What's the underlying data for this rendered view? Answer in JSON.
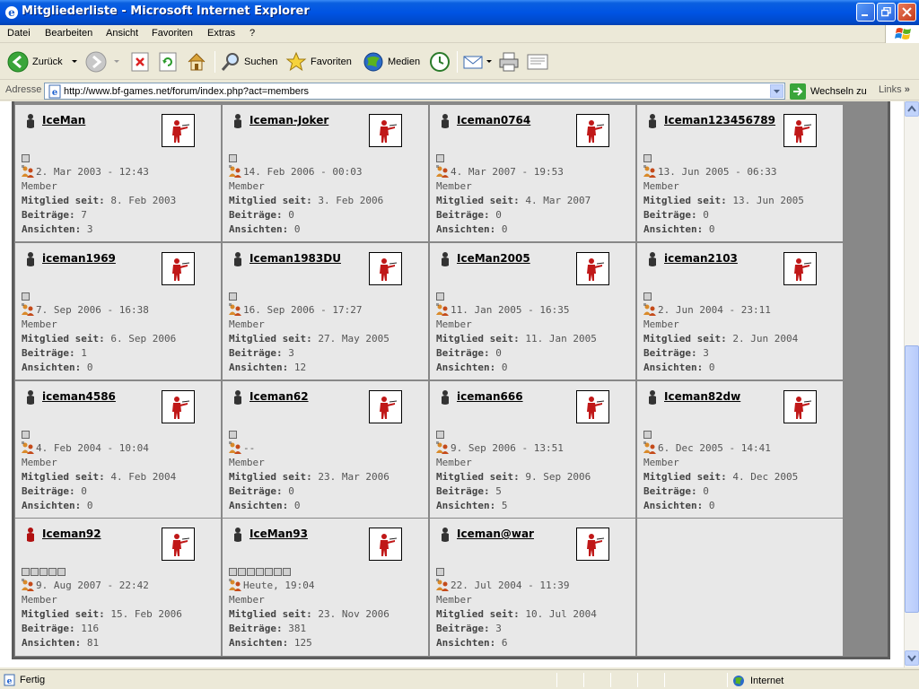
{
  "window": {
    "title": "Mitgliederliste - Microsoft Internet Explorer"
  },
  "menu": [
    "Datei",
    "Bearbeiten",
    "Ansicht",
    "Favoriten",
    "Extras",
    "?"
  ],
  "toolbar": {
    "back": "Zurück",
    "search": "Suchen",
    "favorites": "Favoriten",
    "media": "Medien"
  },
  "address": {
    "label": "Adresse",
    "url": "http://www.bf-games.net/forum/index.php?act=members",
    "go": "Wechseln zu",
    "links": "Links"
  },
  "status": {
    "text": "Fertig",
    "zone": "Internet"
  },
  "members": [
    {
      "name": "IceMan",
      "pips": 1,
      "last": "2. Mar 2003 - 12:43",
      "rank": "Member",
      "since_label": "Mitglied seit:",
      "since": "8. Feb 2003",
      "posts_label": "Beiträge:",
      "posts": "7",
      "views_label": "Ansichten:",
      "views": "3",
      "icon_color": "#333"
    },
    {
      "name": "Iceman-Joker",
      "pips": 1,
      "last": "14. Feb 2006 - 00:03",
      "rank": "Member",
      "since_label": "Mitglied seit:",
      "since": "3. Feb 2006",
      "posts_label": "Beiträge:",
      "posts": "0",
      "views_label": "Ansichten:",
      "views": "0",
      "icon_color": "#333"
    },
    {
      "name": "Iceman0764",
      "pips": 1,
      "last": "4. Mar 2007 - 19:53",
      "rank": "Member",
      "since_label": "Mitglied seit:",
      "since": "4. Mar 2007",
      "posts_label": "Beiträge:",
      "posts": "0",
      "views_label": "Ansichten:",
      "views": "0",
      "icon_color": "#333"
    },
    {
      "name": "Iceman123456789",
      "pips": 1,
      "last": "13. Jun 2005 - 06:33",
      "rank": "Member",
      "since_label": "Mitglied seit:",
      "since": "13. Jun 2005",
      "posts_label": "Beiträge:",
      "posts": "0",
      "views_label": "Ansichten:",
      "views": "0",
      "icon_color": "#333"
    },
    {
      "name": "iceman1969",
      "pips": 1,
      "last": "7. Sep 2006 - 16:38",
      "rank": "Member",
      "since_label": "Mitglied seit:",
      "since": "6. Sep 2006",
      "posts_label": "Beiträge:",
      "posts": "1",
      "views_label": "Ansichten:",
      "views": "0",
      "icon_color": "#333"
    },
    {
      "name": "Iceman1983DU",
      "pips": 1,
      "last": "16. Sep 2006 - 17:27",
      "rank": "Member",
      "since_label": "Mitglied seit:",
      "since": "27. May 2005",
      "posts_label": "Beiträge:",
      "posts": "3",
      "views_label": "Ansichten:",
      "views": "12",
      "icon_color": "#333"
    },
    {
      "name": "IceMan2005",
      "pips": 1,
      "last": "11. Jan 2005 - 16:35",
      "rank": "Member",
      "since_label": "Mitglied seit:",
      "since": "11. Jan 2005",
      "posts_label": "Beiträge:",
      "posts": "0",
      "views_label": "Ansichten:",
      "views": "0",
      "icon_color": "#333"
    },
    {
      "name": "iceman2103",
      "pips": 1,
      "last": "2. Jun 2004 - 23:11",
      "rank": "Member",
      "since_label": "Mitglied seit:",
      "since": "2. Jun 2004",
      "posts_label": "Beiträge:",
      "posts": "3",
      "views_label": "Ansichten:",
      "views": "0",
      "icon_color": "#333"
    },
    {
      "name": "iceman4586",
      "pips": 1,
      "last": "4. Feb 2004 - 10:04",
      "rank": "Member",
      "since_label": "Mitglied seit:",
      "since": "4. Feb 2004",
      "posts_label": "Beiträge:",
      "posts": "0",
      "views_label": "Ansichten:",
      "views": "0",
      "icon_color": "#333"
    },
    {
      "name": "Iceman62",
      "pips": 1,
      "last": "--",
      "rank": "Member",
      "since_label": "Mitglied seit:",
      "since": "23. Mar 2006",
      "posts_label": "Beiträge:",
      "posts": "0",
      "views_label": "Ansichten:",
      "views": "0",
      "icon_color": "#333"
    },
    {
      "name": "iceman666",
      "pips": 1,
      "last": "9. Sep 2006 - 13:51",
      "rank": "Member",
      "since_label": "Mitglied seit:",
      "since": "9. Sep 2006",
      "posts_label": "Beiträge:",
      "posts": "5",
      "views_label": "Ansichten:",
      "views": "5",
      "icon_color": "#333"
    },
    {
      "name": "Iceman82dw",
      "pips": 1,
      "last": "6. Dec 2005 - 14:41",
      "rank": "Member",
      "since_label": "Mitglied seit:",
      "since": "4. Dec 2005",
      "posts_label": "Beiträge:",
      "posts": "0",
      "views_label": "Ansichten:",
      "views": "0",
      "icon_color": "#333"
    },
    {
      "name": "Iceman92",
      "pips": 5,
      "last": "9. Aug 2007 - 22:42",
      "rank": "Member",
      "since_label": "Mitglied seit:",
      "since": "15. Feb 2006",
      "posts_label": "Beiträge:",
      "posts": "116",
      "views_label": "Ansichten:",
      "views": "81",
      "icon_color": "#b01010"
    },
    {
      "name": "IceMan93",
      "pips": 7,
      "last": "Heute, 19:04",
      "rank": "Member",
      "since_label": "Mitglied seit:",
      "since": "23. Nov 2006",
      "posts_label": "Beiträge:",
      "posts": "381",
      "views_label": "Ansichten:",
      "views": "125",
      "icon_color": "#333"
    },
    {
      "name": "Iceman@war",
      "pips": 1,
      "last": "22. Jul 2004 - 11:39",
      "rank": "Member",
      "since_label": "Mitglied seit:",
      "since": "10. Jul 2004",
      "posts_label": "Beiträge:",
      "posts": "3",
      "views_label": "Ansichten:",
      "views": "6",
      "icon_color": "#333"
    }
  ]
}
